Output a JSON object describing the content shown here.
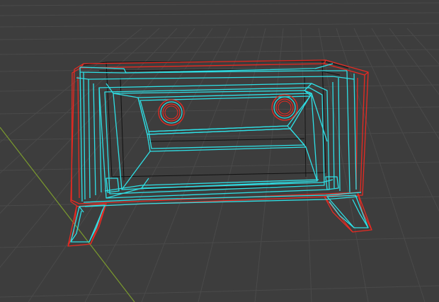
{
  "viewport": {
    "view": "3d-perspective",
    "background_color": "#3d3d3d",
    "grid_line_color": "#4a4a4a",
    "y_axis_color": "#7a9a2e"
  },
  "object": {
    "kind": "cassette-tape-wireframe",
    "display_mode": "wireframe",
    "outer_shell_color": "#e82a22",
    "inner_edge_color": "#2ee0e6",
    "hidden_edge_color": "#111111",
    "reels": [
      "left-reel",
      "right-reel"
    ],
    "feet": [
      "left-foot",
      "right-foot"
    ]
  }
}
